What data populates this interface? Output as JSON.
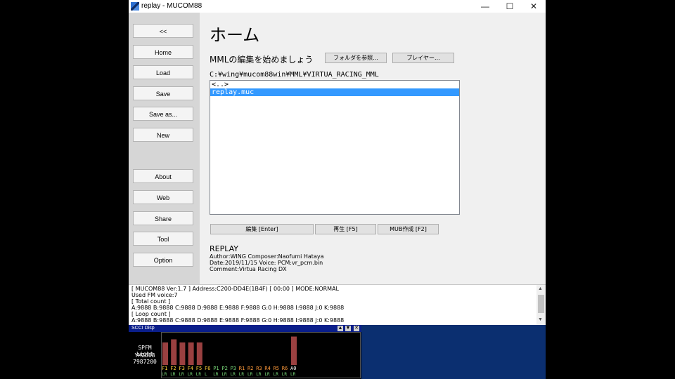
{
  "window": {
    "title": "replay - MUCOM88",
    "minimize_glyph": "—",
    "maximize_glyph": "☐",
    "close_glyph": "✕"
  },
  "sidebar": {
    "collapse_label": "<<",
    "items": [
      {
        "label": "Home"
      },
      {
        "label": "Load"
      },
      {
        "label": "Save"
      },
      {
        "label": "Save as..."
      },
      {
        "label": "New"
      },
      {
        "label": "About"
      },
      {
        "label": "Web"
      },
      {
        "label": "Share"
      },
      {
        "label": "Tool"
      },
      {
        "label": "Option"
      }
    ]
  },
  "main": {
    "title": "ホーム",
    "mml_label": "MMLの編集を始めましょう",
    "browse_folder_button": "フォルダを参照...",
    "player_button": "プレイヤー...",
    "current_path": "C:¥wing¥mucom88win¥MML¥VIRTUA_RACING_MML",
    "files": [
      {
        "name": "<..>",
        "selected": false
      },
      {
        "name": "replay.muc",
        "selected": true
      }
    ],
    "edit_button": "編集 [Enter]",
    "play_button": "再生 [F5]",
    "mub_button": "MUB作成 [F2]",
    "song": {
      "title": "REPLAY",
      "author_line": "Author:WING  Composer:Naofumi Hataya",
      "date_line": "Date:2019/11/15  Voice:  PCM:vr_pcm.bin",
      "comment_line": "Comment:Virtua Racing DX"
    }
  },
  "log": {
    "lines": [
      "[  MUCOM88 Ver:1.7  ]  Address:C200-DD4E(1B4F)          [ 00:00 ] MODE:NORMAL",
      "Used FM voice:7",
      "[ Total count ]",
      "A:9888  B:9888  C:9888  D:9888  E:9888  F:9888  G:0  H:9888  I:9888  J:0  K:9888",
      "[ Loop count  ]",
      "A:9888  B:9888  C:9888  D:9888  E:9888  F:9888  G:0  H:9888  I:9888  J:0  K:9888"
    ]
  },
  "scci": {
    "title": "SCCI Disp",
    "device_name": "SPFM Light",
    "chip": "YM2608",
    "clock": "7987200",
    "channels": [
      {
        "label": "F1",
        "level": 0.73,
        "color": "#ffd23a"
      },
      {
        "label": "F2",
        "level": 0.83,
        "color": "#ffd23a"
      },
      {
        "label": "F3",
        "level": 0.73,
        "color": "#ffd23a"
      },
      {
        "label": "F4",
        "level": 0.73,
        "color": "#ffd23a"
      },
      {
        "label": "F5",
        "level": 0.73,
        "color": "#ffd23a"
      },
      {
        "label": "F6",
        "level": 0,
        "color": "#ffd23a"
      },
      {
        "label": "P1",
        "level": 0,
        "color": "#7de07d"
      },
      {
        "label": "P2",
        "level": 0,
        "color": "#7de07d"
      },
      {
        "label": "P3",
        "level": 0,
        "color": "#7de07d"
      },
      {
        "label": "R1",
        "level": 0,
        "color": "#ff9a3a"
      },
      {
        "label": "R2",
        "level": 0,
        "color": "#ff9a3a"
      },
      {
        "label": "R3",
        "level": 0,
        "color": "#ff9a3a"
      },
      {
        "label": "R4",
        "level": 0,
        "color": "#ff9a3a"
      },
      {
        "label": "R5",
        "level": 0,
        "color": "#ff9a3a"
      },
      {
        "label": "R6",
        "level": 0,
        "color": "#ff9a3a"
      },
      {
        "label": "A0",
        "level": 0.92,
        "color": "#ffffff"
      }
    ],
    "pan_labels": [
      "LR",
      "LR",
      "LR",
      "LR",
      "LR",
      "L",
      "LR",
      "LR",
      "LR",
      "LR",
      "LR",
      "LR",
      "LR",
      "LR",
      "LR",
      "LR"
    ],
    "bar_color": "#9a4040",
    "pan_color": "#7de07d"
  },
  "colors": {
    "selection": "#3399ff",
    "scci_title_bg": "#0a1e8a",
    "backdrop_blue": "#0b2f70"
  }
}
